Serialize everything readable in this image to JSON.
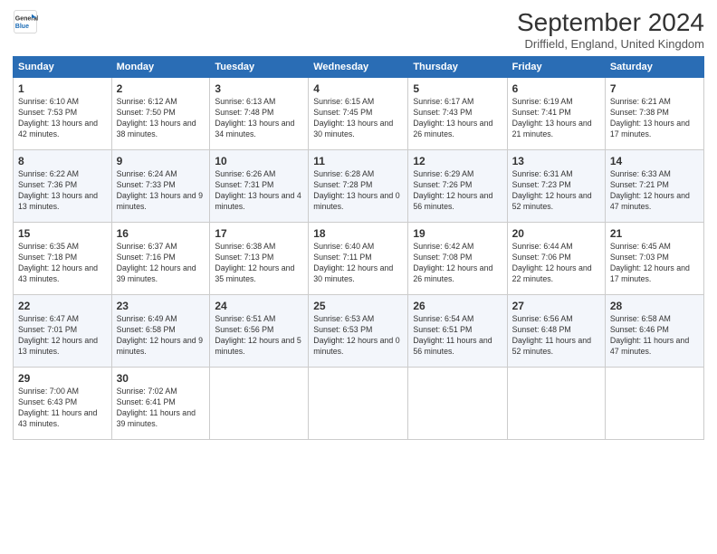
{
  "logo": {
    "line1": "General",
    "line2": "Blue"
  },
  "title": "September 2024",
  "location": "Driffield, England, United Kingdom",
  "days_header": [
    "Sunday",
    "Monday",
    "Tuesday",
    "Wednesday",
    "Thursday",
    "Friday",
    "Saturday"
  ],
  "weeks": [
    [
      {
        "day": "1",
        "sunrise": "Sunrise: 6:10 AM",
        "sunset": "Sunset: 7:53 PM",
        "daylight": "Daylight: 13 hours and 42 minutes."
      },
      {
        "day": "2",
        "sunrise": "Sunrise: 6:12 AM",
        "sunset": "Sunset: 7:50 PM",
        "daylight": "Daylight: 13 hours and 38 minutes."
      },
      {
        "day": "3",
        "sunrise": "Sunrise: 6:13 AM",
        "sunset": "Sunset: 7:48 PM",
        "daylight": "Daylight: 13 hours and 34 minutes."
      },
      {
        "day": "4",
        "sunrise": "Sunrise: 6:15 AM",
        "sunset": "Sunset: 7:45 PM",
        "daylight": "Daylight: 13 hours and 30 minutes."
      },
      {
        "day": "5",
        "sunrise": "Sunrise: 6:17 AM",
        "sunset": "Sunset: 7:43 PM",
        "daylight": "Daylight: 13 hours and 26 minutes."
      },
      {
        "day": "6",
        "sunrise": "Sunrise: 6:19 AM",
        "sunset": "Sunset: 7:41 PM",
        "daylight": "Daylight: 13 hours and 21 minutes."
      },
      {
        "day": "7",
        "sunrise": "Sunrise: 6:21 AM",
        "sunset": "Sunset: 7:38 PM",
        "daylight": "Daylight: 13 hours and 17 minutes."
      }
    ],
    [
      {
        "day": "8",
        "sunrise": "Sunrise: 6:22 AM",
        "sunset": "Sunset: 7:36 PM",
        "daylight": "Daylight: 13 hours and 13 minutes."
      },
      {
        "day": "9",
        "sunrise": "Sunrise: 6:24 AM",
        "sunset": "Sunset: 7:33 PM",
        "daylight": "Daylight: 13 hours and 9 minutes."
      },
      {
        "day": "10",
        "sunrise": "Sunrise: 6:26 AM",
        "sunset": "Sunset: 7:31 PM",
        "daylight": "Daylight: 13 hours and 4 minutes."
      },
      {
        "day": "11",
        "sunrise": "Sunrise: 6:28 AM",
        "sunset": "Sunset: 7:28 PM",
        "daylight": "Daylight: 13 hours and 0 minutes."
      },
      {
        "day": "12",
        "sunrise": "Sunrise: 6:29 AM",
        "sunset": "Sunset: 7:26 PM",
        "daylight": "Daylight: 12 hours and 56 minutes."
      },
      {
        "day": "13",
        "sunrise": "Sunrise: 6:31 AM",
        "sunset": "Sunset: 7:23 PM",
        "daylight": "Daylight: 12 hours and 52 minutes."
      },
      {
        "day": "14",
        "sunrise": "Sunrise: 6:33 AM",
        "sunset": "Sunset: 7:21 PM",
        "daylight": "Daylight: 12 hours and 47 minutes."
      }
    ],
    [
      {
        "day": "15",
        "sunrise": "Sunrise: 6:35 AM",
        "sunset": "Sunset: 7:18 PM",
        "daylight": "Daylight: 12 hours and 43 minutes."
      },
      {
        "day": "16",
        "sunrise": "Sunrise: 6:37 AM",
        "sunset": "Sunset: 7:16 PM",
        "daylight": "Daylight: 12 hours and 39 minutes."
      },
      {
        "day": "17",
        "sunrise": "Sunrise: 6:38 AM",
        "sunset": "Sunset: 7:13 PM",
        "daylight": "Daylight: 12 hours and 35 minutes."
      },
      {
        "day": "18",
        "sunrise": "Sunrise: 6:40 AM",
        "sunset": "Sunset: 7:11 PM",
        "daylight": "Daylight: 12 hours and 30 minutes."
      },
      {
        "day": "19",
        "sunrise": "Sunrise: 6:42 AM",
        "sunset": "Sunset: 7:08 PM",
        "daylight": "Daylight: 12 hours and 26 minutes."
      },
      {
        "day": "20",
        "sunrise": "Sunrise: 6:44 AM",
        "sunset": "Sunset: 7:06 PM",
        "daylight": "Daylight: 12 hours and 22 minutes."
      },
      {
        "day": "21",
        "sunrise": "Sunrise: 6:45 AM",
        "sunset": "Sunset: 7:03 PM",
        "daylight": "Daylight: 12 hours and 17 minutes."
      }
    ],
    [
      {
        "day": "22",
        "sunrise": "Sunrise: 6:47 AM",
        "sunset": "Sunset: 7:01 PM",
        "daylight": "Daylight: 12 hours and 13 minutes."
      },
      {
        "day": "23",
        "sunrise": "Sunrise: 6:49 AM",
        "sunset": "Sunset: 6:58 PM",
        "daylight": "Daylight: 12 hours and 9 minutes."
      },
      {
        "day": "24",
        "sunrise": "Sunrise: 6:51 AM",
        "sunset": "Sunset: 6:56 PM",
        "daylight": "Daylight: 12 hours and 5 minutes."
      },
      {
        "day": "25",
        "sunrise": "Sunrise: 6:53 AM",
        "sunset": "Sunset: 6:53 PM",
        "daylight": "Daylight: 12 hours and 0 minutes."
      },
      {
        "day": "26",
        "sunrise": "Sunrise: 6:54 AM",
        "sunset": "Sunset: 6:51 PM",
        "daylight": "Daylight: 11 hours and 56 minutes."
      },
      {
        "day": "27",
        "sunrise": "Sunrise: 6:56 AM",
        "sunset": "Sunset: 6:48 PM",
        "daylight": "Daylight: 11 hours and 52 minutes."
      },
      {
        "day": "28",
        "sunrise": "Sunrise: 6:58 AM",
        "sunset": "Sunset: 6:46 PM",
        "daylight": "Daylight: 11 hours and 47 minutes."
      }
    ],
    [
      {
        "day": "29",
        "sunrise": "Sunrise: 7:00 AM",
        "sunset": "Sunset: 6:43 PM",
        "daylight": "Daylight: 11 hours and 43 minutes."
      },
      {
        "day": "30",
        "sunrise": "Sunrise: 7:02 AM",
        "sunset": "Sunset: 6:41 PM",
        "daylight": "Daylight: 11 hours and 39 minutes."
      },
      null,
      null,
      null,
      null,
      null
    ]
  ]
}
